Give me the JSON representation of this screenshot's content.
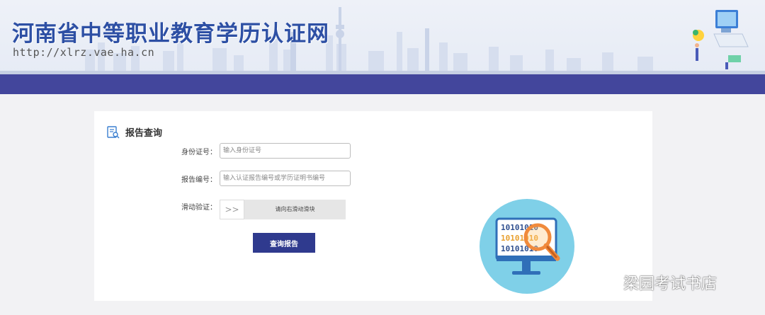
{
  "header": {
    "title": "河南省中等职业教育学历认证网",
    "url": "http://xlrz.vae.ha.cn"
  },
  "card": {
    "title": "报告查询",
    "id_label": "身份证号：",
    "id_placeholder": "输入身份证号",
    "report_label": "报告编号：",
    "report_placeholder": "输入认证报告编号或学历证明书编号",
    "slider_label": "滑动验证：",
    "slider_handle": ">>",
    "slider_hint": "请向右滑动滑块",
    "submit_label": "查询报告"
  },
  "illustration": {
    "binary_rows": [
      "10101010",
      "10101010",
      "10101010"
    ]
  },
  "watermark": {
    "text": "梁园考试书店"
  },
  "colors": {
    "brand_blue": "#2d4fa4",
    "navbar": "#43469c",
    "button": "#2f3a8e",
    "illustration_circle": "#7fd0e8"
  }
}
